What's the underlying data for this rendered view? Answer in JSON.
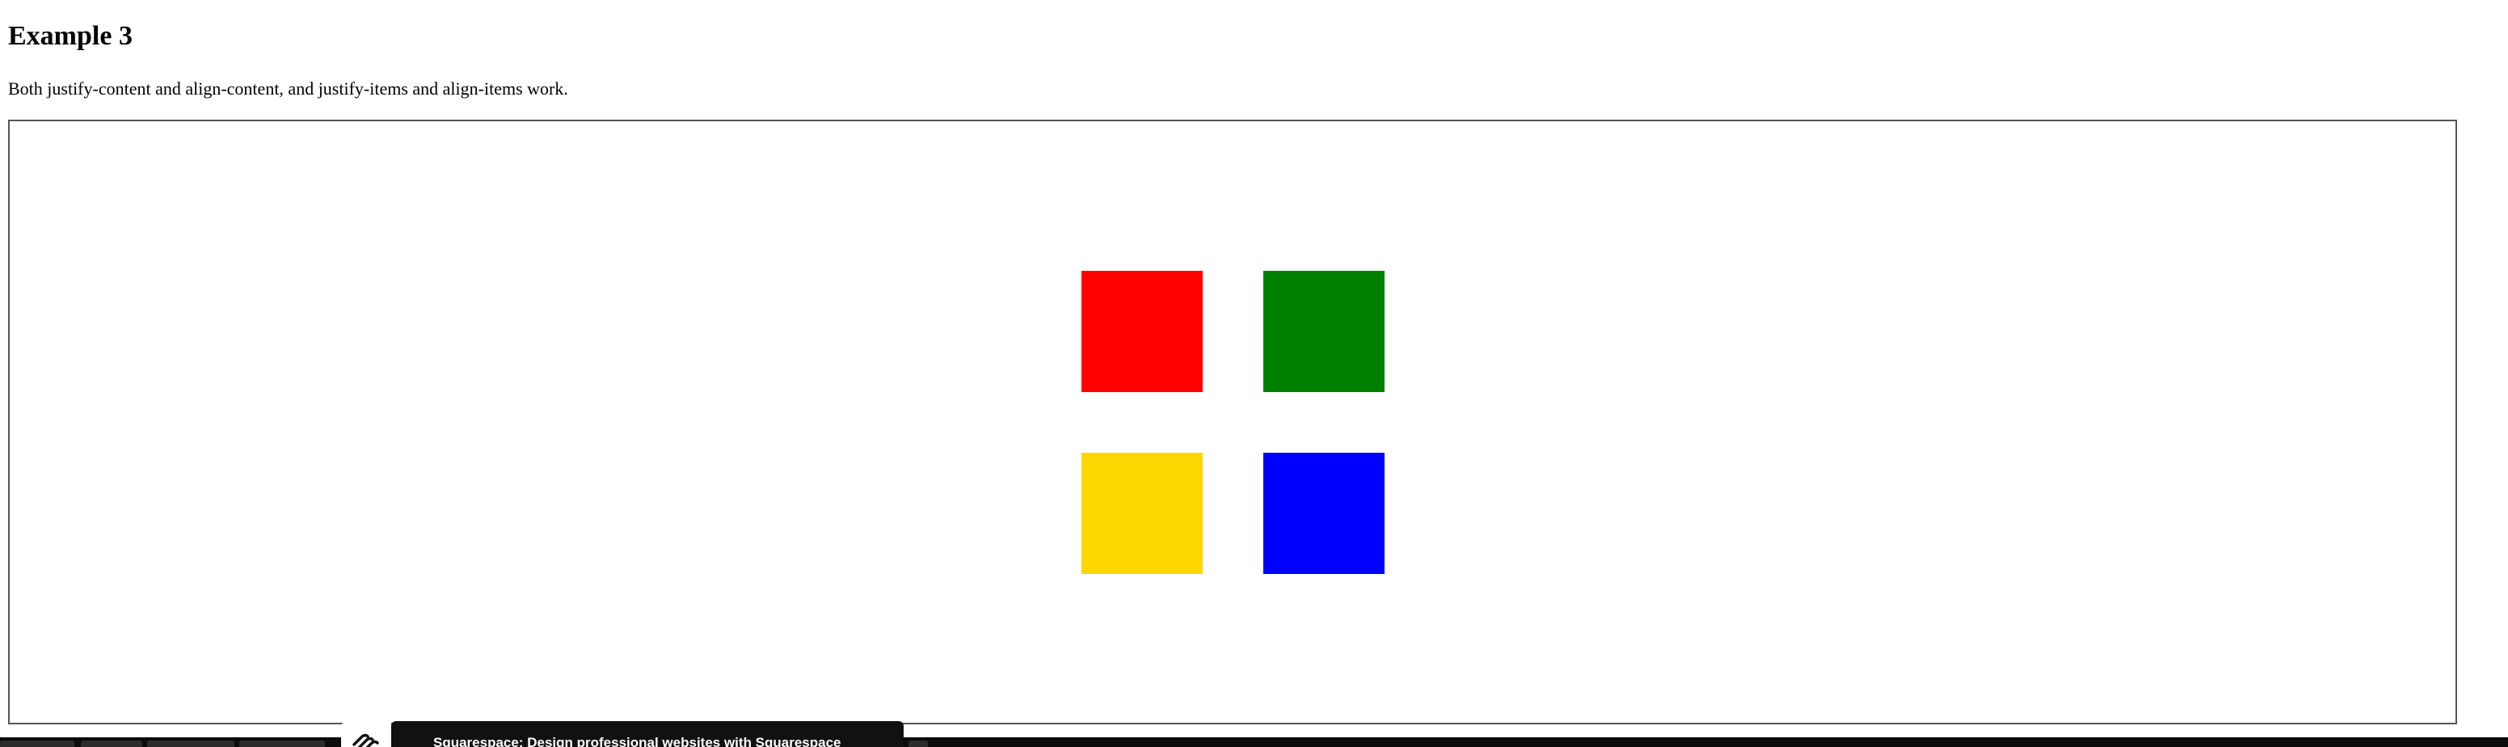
{
  "page": {
    "title": "Example 3",
    "description": "Both justify-content and align-content, and justify-items and align-items work."
  },
  "grid": {
    "items": [
      {
        "name": "red",
        "color": "#ff0000"
      },
      {
        "name": "green",
        "color": "#008000"
      },
      {
        "name": "gold",
        "color": "#ffd700"
      },
      {
        "name": "blue",
        "color": "#0000ff"
      }
    ]
  },
  "ad": {
    "icon": "squarespace-logo-icon",
    "text": "Squarespace: Design professional websites with Squarespace"
  }
}
